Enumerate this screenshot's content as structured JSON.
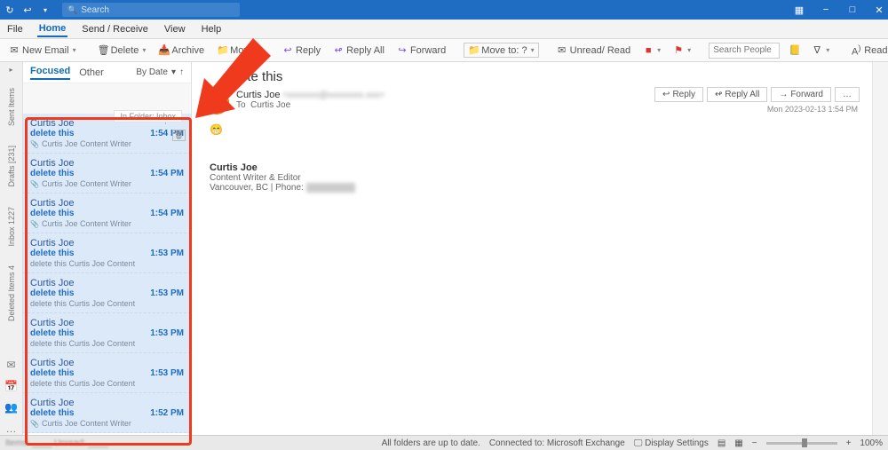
{
  "titlebar": {
    "search_placeholder": "Search"
  },
  "menubar": {
    "items": [
      "File",
      "Home",
      "Send / Receive",
      "View",
      "Help"
    ],
    "active_index": 1
  },
  "ribbon": {
    "new_email": "New Email",
    "delete": "Delete",
    "archive": "Archive",
    "move": "Move",
    "reply": "Reply",
    "reply_all": "Reply All",
    "forward": "Forward",
    "move_to": "Move to: ?",
    "unread_read": "Unread/ Read",
    "search_people_placeholder": "Search People",
    "read_aloud": "Read Aloud"
  },
  "rail": {
    "folders": [
      "Sent Items",
      "Drafts [231]",
      "Inbox 1227",
      "Deleted Items 4"
    ]
  },
  "msglist": {
    "tab_focused": "Focused",
    "tab_other": "Other",
    "sort_label": "By Date",
    "folder_tooltip": "In Folder: Inbox",
    "messages": [
      {
        "from": "Curtis Joe",
        "subject": "delete this",
        "time": "1:54 PM",
        "preview": "Curtis Joe  Content Writer",
        "attach": true,
        "flag": true,
        "del": true
      },
      {
        "from": "Curtis Joe",
        "subject": "delete this",
        "time": "1:54 PM",
        "preview": "Curtis Joe  Content Writer",
        "attach": true
      },
      {
        "from": "Curtis Joe",
        "subject": "delete this",
        "time": "1:54 PM",
        "preview": "Curtis Joe  Content Writer",
        "attach": true
      },
      {
        "from": "Curtis Joe",
        "subject": "delete this",
        "time": "1:53 PM",
        "preview": "delete this  Curtis Joe  Content"
      },
      {
        "from": "Curtis Joe",
        "subject": "delete this",
        "time": "1:53 PM",
        "preview": "delete this  Curtis Joe  Content"
      },
      {
        "from": "Curtis Joe",
        "subject": "delete this",
        "time": "1:53 PM",
        "preview": "delete this  Curtis Joe  Content"
      },
      {
        "from": "Curtis Joe",
        "subject": "delete this",
        "time": "1:53 PM",
        "preview": "delete this  Curtis Joe  Content"
      },
      {
        "from": "Curtis Joe",
        "subject": "delete this",
        "time": "1:52 PM",
        "preview": "Curtis Joe  Content Writer",
        "attach": true
      }
    ]
  },
  "reading": {
    "title": "delete this",
    "from_name": "Curtis Joe",
    "to_label": "To",
    "to_name": "Curtis Joe",
    "date": "Mon 2023-02-13 1:54 PM",
    "actions": {
      "reply": "Reply",
      "reply_all": "Reply All",
      "forward": "Forward"
    },
    "signature": {
      "name": "Curtis Joe",
      "role": "Content Writer & Editor",
      "location": "Vancouver, BC | Phone:"
    }
  },
  "statusbar": {
    "items_blur": "Items: ____    Unread: ____",
    "all_folders": "All folders are up to date.",
    "connected": "Connected to: Microsoft Exchange",
    "display_settings": "Display Settings",
    "zoom": "100%"
  }
}
